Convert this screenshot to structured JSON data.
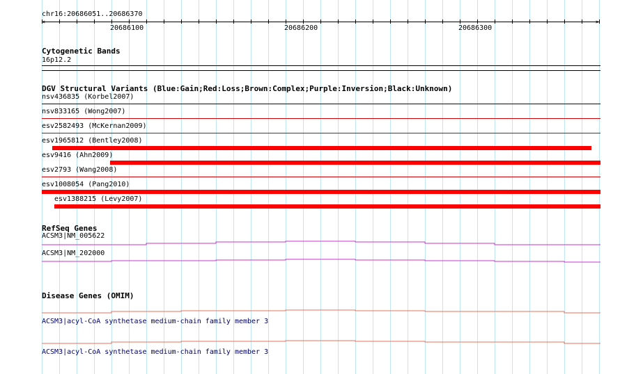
{
  "ruler": {
    "coords": "chr16:20686051..20686370",
    "ticks": [
      "20686100",
      "20686200",
      "20686300"
    ]
  },
  "cytoband": {
    "title": "Cytogenetic Bands",
    "band": "16p12.2"
  },
  "dgv": {
    "title": "DGV Structural Variants (Blue:Gain;Red:Loss;Brown:Complex;Purple:Inversion;Black:Unknown)",
    "variants": [
      {
        "label": "nsv436835 (Korbel2007)",
        "color": "#000080"
      },
      {
        "label": "nsv833165 (Wong2007)",
        "color": "#cc0000"
      },
      {
        "label": "esv2582493 (McKernan2009)",
        "color": "#cc0000"
      },
      {
        "label": "esv1965812 (Bentley2008)",
        "color": "#cc0000"
      },
      {
        "label": "esv9416 (Ahn2009)",
        "color": "#cc0000"
      },
      {
        "label": "esv2793 (Wang2008)",
        "color": "#cc0000"
      },
      {
        "label": "esv1008054 (Pang2010)",
        "color": "#cc0000"
      },
      {
        "label": "esv1388215 (Levy2007)",
        "color": "#cc0000"
      }
    ]
  },
  "refseq": {
    "title": "RefSeq Genes",
    "genes": [
      "ACSM3|NM_005622",
      "ACSM3|NM_202000"
    ],
    "color": "#cc33cc"
  },
  "omim": {
    "title": "Disease Genes (OMIM)",
    "genes": [
      "ACSM3|acyl-CoA synthetase medium-chain family member 3",
      "ACSM3|acyl-CoA synthetase medium-chain family member 3"
    ],
    "color": "#e8705a"
  },
  "colors": {
    "grid": "#bfe6f2",
    "loss_bar": "#ff0000",
    "label_text": "#000066"
  }
}
